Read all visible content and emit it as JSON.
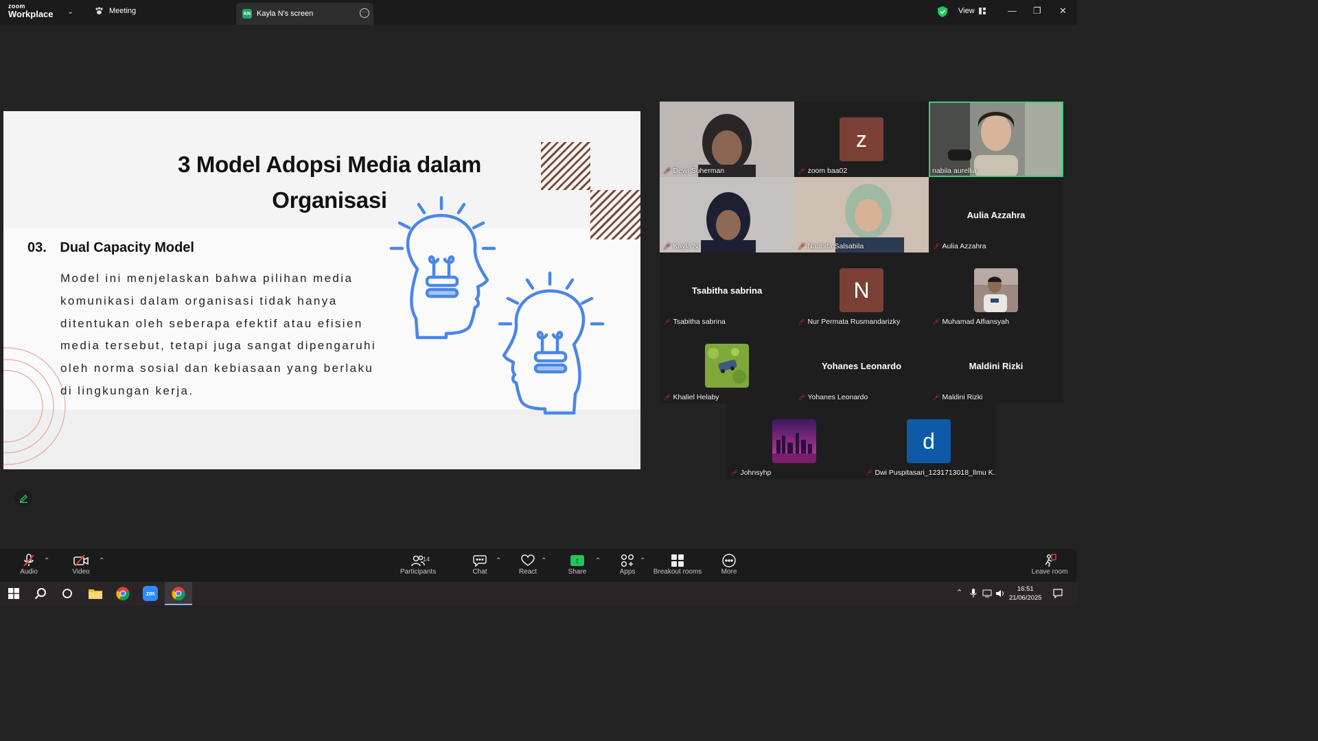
{
  "titlebar": {
    "logo_top": "zoom",
    "logo_bottom": "Workplace",
    "meeting_label": "Meeting",
    "screen_badge": "KN",
    "screen_tab_label": "Kayla N's screen",
    "view_label": "View"
  },
  "slide": {
    "title_line1": "3 Model Adopsi Media dalam",
    "title_line2": "Organisasi",
    "subhead_number": "03.",
    "subhead_title": "Dual Capacity Model",
    "body_lines": [
      "Model ini menjelaskan bahwa pilihan media",
      "komunikasi dalam organisasi tidak hanya",
      "ditentukan oleh seberapa efektif atau efisien",
      "media tersebut, tetapi juga sangat dipengaruhi",
      "oleh norma sosial dan kebiasaan yang berlaku",
      "di lingkungan kerja."
    ]
  },
  "participants": [
    {
      "name": "Dewi Suherman",
      "type": "video"
    },
    {
      "name": "zoom baa02",
      "type": "avatar",
      "letter": "z",
      "color": "#7a4035"
    },
    {
      "name": "nabila aurellia",
      "type": "video",
      "active": true
    },
    {
      "name": "Kayla N",
      "type": "video"
    },
    {
      "name": "Nadhifa Salsabila",
      "type": "video"
    },
    {
      "name": "Aulia Azzahra",
      "type": "name",
      "display": "Aulia Azzahra"
    },
    {
      "name": "Tsabitha sabrina",
      "type": "name",
      "display": "Tsabitha sabrina"
    },
    {
      "name": "Nur Permata Rusmandarizky",
      "type": "avatar",
      "letter": "N",
      "color": "#7a4035"
    },
    {
      "name": "Muhamad Alfiansyah",
      "type": "photo"
    },
    {
      "name": "Khaliel Helaby",
      "type": "photo"
    },
    {
      "name": "Yohanes Leonardo",
      "type": "name",
      "display": "Yohanes Leonardo"
    },
    {
      "name": "Maldini Rizki",
      "type": "name",
      "display": "Maldini Rizki"
    },
    {
      "name": "Johnsyhp",
      "type": "photo"
    },
    {
      "name": "Dwi Puspitasari_1231713018_Ilmu K...",
      "type": "avatar",
      "letter": "d",
      "color": "#0e5aa7"
    }
  ],
  "toolbar": {
    "audio": "Audio",
    "video": "Video",
    "participants": "Participants",
    "participants_count": "14",
    "chat": "Chat",
    "react": "React",
    "share": "Share",
    "apps": "Apps",
    "breakout": "Breakout rooms",
    "more": "More",
    "leave": "Leave room"
  },
  "taskbar": {
    "time": "16:51",
    "date": "21/06/2025",
    "zoom_label": "zm"
  },
  "colors": {
    "accent_green": "#21c55d",
    "bulb_blue": "#4a86e8",
    "hatch_brown": "#7a4b3a"
  }
}
